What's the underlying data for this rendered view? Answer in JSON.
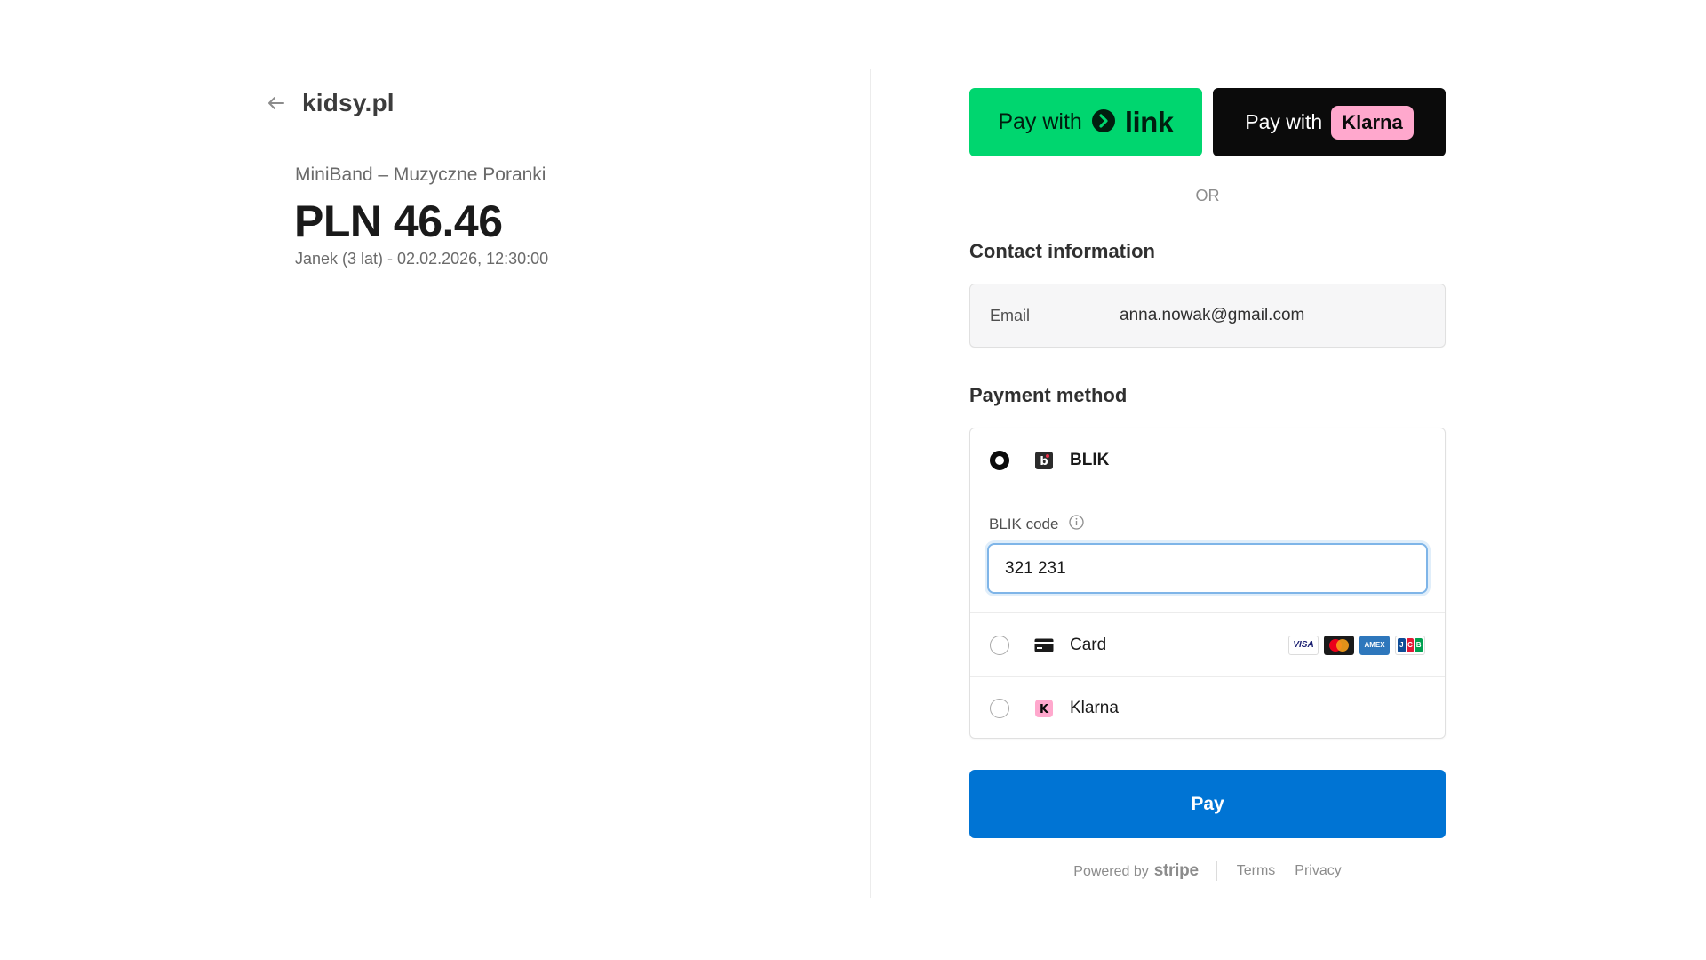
{
  "merchant": {
    "name": "kidsy.pl",
    "back_icon": "arrow-left-icon"
  },
  "order": {
    "product": "MiniBand – Muzyczne Poranki",
    "amount": "PLN 46.46",
    "description": "Janek (3 lat) - 02.02.2026, 12:30:00"
  },
  "express": {
    "link_prefix": "Pay with",
    "link_word": "link",
    "klarna_prefix": "Pay with",
    "klarna_word": "Klarna",
    "or_text": "OR",
    "link_color": "#00d66f",
    "klarna_pink": "#ffa8cd"
  },
  "contact": {
    "title": "Contact information",
    "email_label": "Email",
    "email_value": "anna.nowak@gmail.com"
  },
  "payment": {
    "title": "Payment method",
    "methods": [
      {
        "label": "BLIK",
        "icon": "blik-icon",
        "selected": true
      },
      {
        "label": "Card",
        "icon": "card-icon",
        "selected": false
      },
      {
        "label": "Klarna",
        "icon": "klarna-icon",
        "selected": false
      }
    ],
    "blik_code_label": "BLIK code",
    "blik_code_value": "321 231",
    "card_brands": {
      "visa": "VISA",
      "amex": "AMEX",
      "jcb": [
        "J",
        "C",
        "B"
      ]
    }
  },
  "pay_button": {
    "label": "Pay",
    "color": "#0074d4"
  },
  "footer": {
    "powered_by": "Powered by",
    "stripe": "stripe",
    "terms": "Terms",
    "privacy": "Privacy"
  }
}
